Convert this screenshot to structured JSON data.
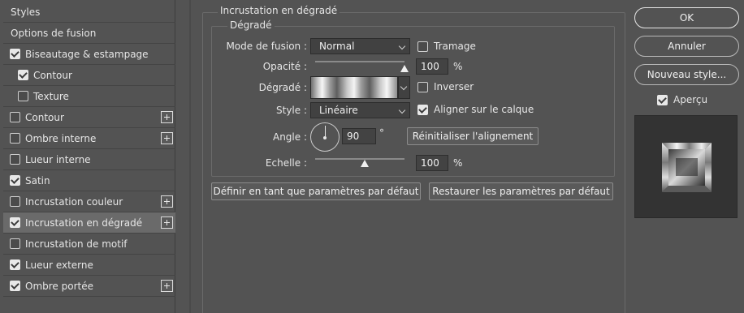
{
  "styles_list": {
    "items": [
      {
        "label": "Styles",
        "checkbox": false,
        "checked": false,
        "plus": false,
        "indent": false,
        "active": false
      },
      {
        "label": "Options de fusion",
        "checkbox": false,
        "checked": false,
        "plus": false,
        "indent": false,
        "active": false
      },
      {
        "label": "Biseautage & estampage",
        "checkbox": true,
        "checked": true,
        "plus": false,
        "indent": false,
        "active": false
      },
      {
        "label": "Contour",
        "checkbox": true,
        "checked": true,
        "plus": false,
        "indent": true,
        "active": false
      },
      {
        "label": "Texture",
        "checkbox": true,
        "checked": false,
        "plus": false,
        "indent": true,
        "active": false
      },
      {
        "label": "Contour",
        "checkbox": true,
        "checked": false,
        "plus": true,
        "indent": false,
        "active": false
      },
      {
        "label": "Ombre interne",
        "checkbox": true,
        "checked": false,
        "plus": true,
        "indent": false,
        "active": false
      },
      {
        "label": "Lueur interne",
        "checkbox": true,
        "checked": false,
        "plus": false,
        "indent": false,
        "active": false
      },
      {
        "label": "Satin",
        "checkbox": true,
        "checked": true,
        "plus": false,
        "indent": false,
        "active": false
      },
      {
        "label": "Incrustation couleur",
        "checkbox": true,
        "checked": false,
        "plus": true,
        "indent": false,
        "active": false
      },
      {
        "label": "Incrustation en dégradé",
        "checkbox": true,
        "checked": true,
        "plus": true,
        "indent": false,
        "active": true
      },
      {
        "label": "Incrustation de motif",
        "checkbox": true,
        "checked": false,
        "plus": false,
        "indent": false,
        "active": false
      },
      {
        "label": "Lueur externe",
        "checkbox": true,
        "checked": true,
        "plus": false,
        "indent": false,
        "active": false
      },
      {
        "label": "Ombre portée",
        "checkbox": true,
        "checked": true,
        "plus": true,
        "indent": false,
        "active": false
      }
    ]
  },
  "section": {
    "title": "Incrustation en dégradé",
    "group_title": "Dégradé",
    "blend_mode": {
      "label": "Mode de fusion :",
      "value": "Normal"
    },
    "dither": {
      "label": "Tramage",
      "checked": false
    },
    "opacity": {
      "label": "Opacité :",
      "value": "100",
      "unit": "%",
      "level": 1.0
    },
    "gradient": {
      "label": "Dégradé :"
    },
    "reverse": {
      "label": "Inverser",
      "checked": false
    },
    "style": {
      "label": "Style :",
      "value": "Linéaire"
    },
    "align_with_layer": {
      "label": "Aligner sur le calque",
      "checked": true
    },
    "angle": {
      "label": "Angle :",
      "value": "90",
      "unit": "°"
    },
    "reset_alignment": "Réinitialiser l'alignement",
    "scale": {
      "label": "Echelle :",
      "value": "100",
      "unit": "%",
      "level": 0.55
    },
    "make_default": "Définir en tant que paramètres par défaut",
    "reset_default": "Restaurer les paramètres par défaut"
  },
  "actions": {
    "ok": "OK",
    "cancel": "Annuler",
    "new_style": "Nouveau style...",
    "preview": {
      "label": "Aperçu",
      "checked": true
    }
  },
  "colors": {
    "background": "#535353",
    "active_row": "#6a6a6a",
    "input_bg": "#414141",
    "preview_bg": "#333333"
  }
}
